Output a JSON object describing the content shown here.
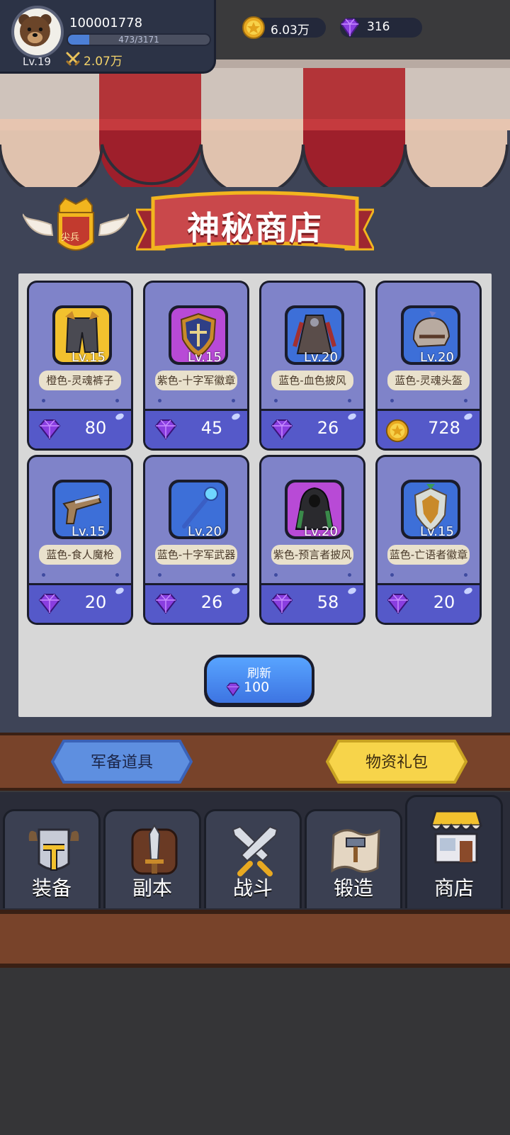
{
  "player": {
    "id": "100001778",
    "level": "Lv.19",
    "exp_text": "473/3171",
    "exp_fraction": 0.149,
    "power": "2.07万",
    "avatar": "bear-avatar"
  },
  "currency": {
    "gold": "6.03万",
    "gems": "316"
  },
  "shop": {
    "title": "神秘商店",
    "rank_badge": "尖兵",
    "items": [
      {
        "name": "橙色-灵魂裤子",
        "level": "Lv.15",
        "price": "80",
        "currency": "gem",
        "rarity_color": "#f2c12e",
        "icon": "pants-icon"
      },
      {
        "name": "紫色-十字军徽章",
        "level": "Lv.15",
        "price": "45",
        "currency": "gem",
        "rarity_color": "#b84ad6",
        "icon": "shield-badge-icon"
      },
      {
        "name": "蓝色-血色披风",
        "level": "Lv.20",
        "price": "26",
        "currency": "gem",
        "rarity_color": "#3d6fd8",
        "icon": "cloak-icon"
      },
      {
        "name": "蓝色-灵魂头盔",
        "level": "Lv.20",
        "price": "728",
        "currency": "gold",
        "rarity_color": "#3d6fd8",
        "icon": "helmet-icon"
      },
      {
        "name": "蓝色-食人魔枪",
        "level": "Lv.15",
        "price": "20",
        "currency": "gem",
        "rarity_color": "#3d6fd8",
        "icon": "pistol-icon"
      },
      {
        "name": "蓝色-十字军武器",
        "level": "Lv.20",
        "price": "26",
        "currency": "gem",
        "rarity_color": "#3d6fd8",
        "icon": "staff-icon"
      },
      {
        "name": "紫色-预言者披风",
        "level": "Lv.20",
        "price": "58",
        "currency": "gem",
        "rarity_color": "#b84ad6",
        "icon": "hooded-cloak-icon"
      },
      {
        "name": "蓝色-亡语者徽章",
        "level": "Lv.15",
        "price": "20",
        "currency": "gem",
        "rarity_color": "#3d6fd8",
        "icon": "emblem-icon"
      }
    ],
    "refresh": {
      "label": "刷新",
      "cost": "100"
    }
  },
  "categories": {
    "equip": "军备道具",
    "pack": "物资礼包"
  },
  "nav": [
    {
      "label": "装备",
      "icon": "armor-icon",
      "active": false
    },
    {
      "label": "副本",
      "icon": "dungeon-sword-icon",
      "active": false
    },
    {
      "label": "战斗",
      "icon": "crossed-swords-icon",
      "active": false
    },
    {
      "label": "锻造",
      "icon": "forge-scroll-icon",
      "active": false
    },
    {
      "label": "商店",
      "icon": "shop-icon",
      "active": true
    }
  ],
  "colors": {
    "gem": "#8a3ee0",
    "gold": "#f5c542",
    "price_bar": "#5559c9",
    "card": "#7f83c9",
    "wood": "#78432a"
  }
}
